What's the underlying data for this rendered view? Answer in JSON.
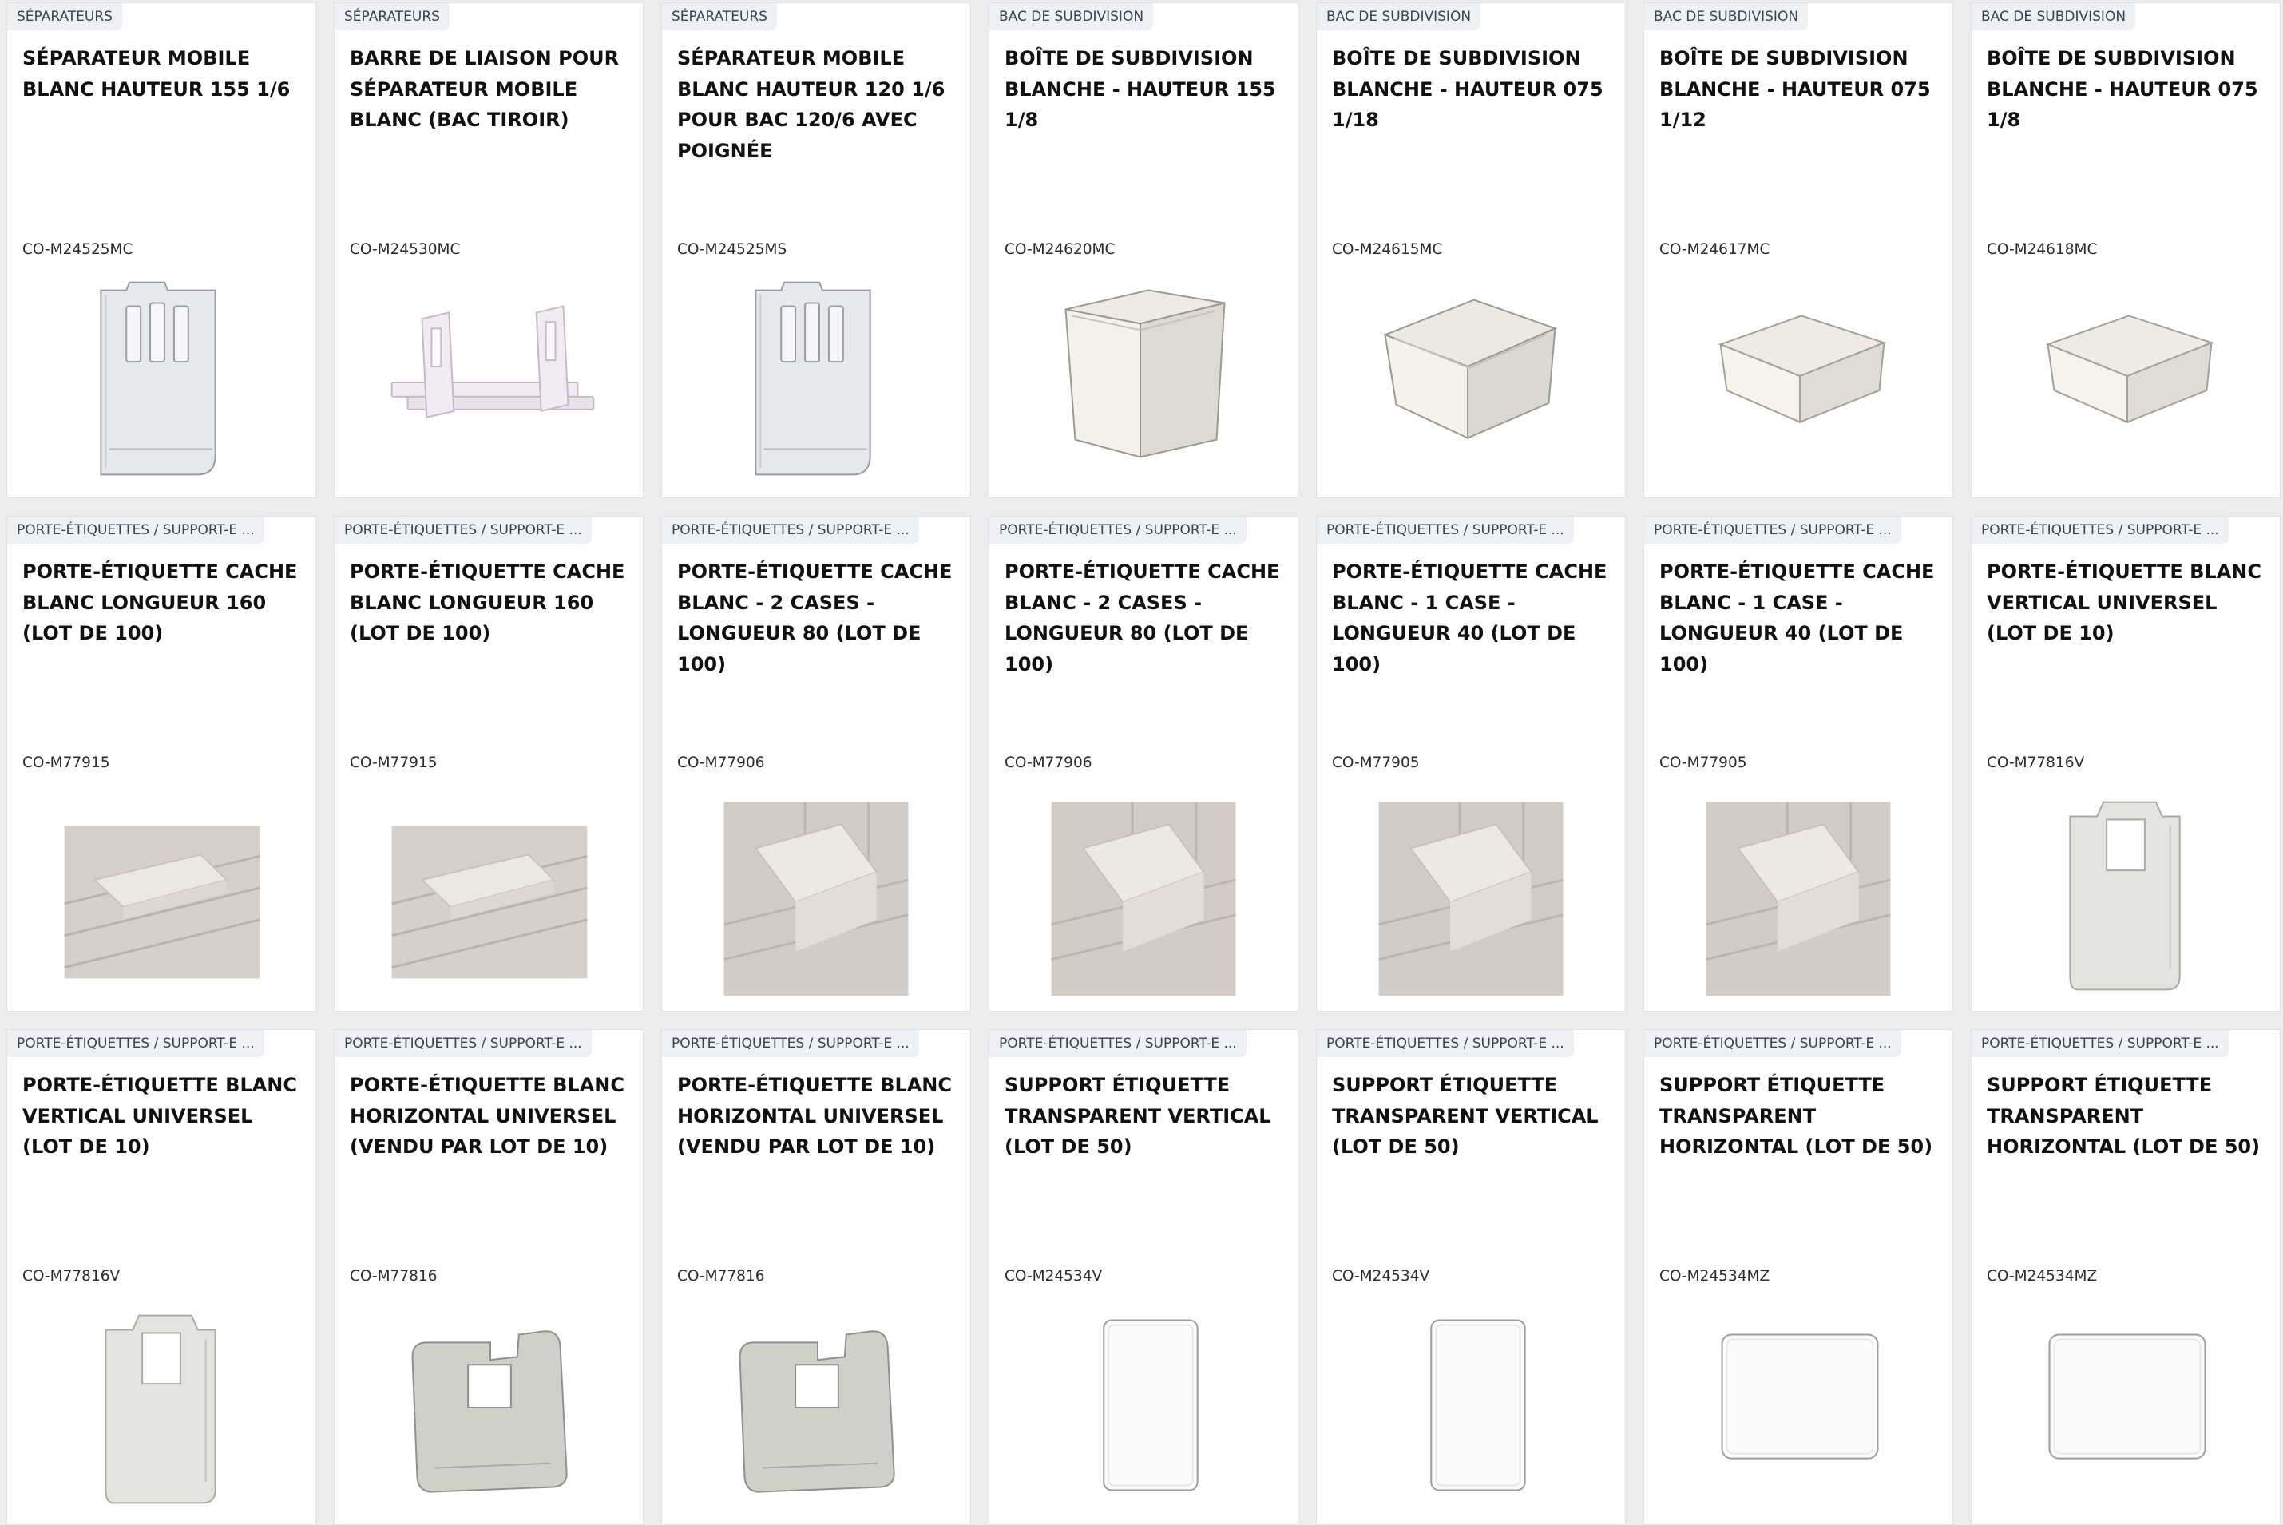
{
  "products": [
    {
      "category": "SÉPARATEURS",
      "title": "SÉPARATEUR MOBILE BLANC HAUTEUR 155 1/6",
      "sku": "CO-M24525MC",
      "image": "tall-divider"
    },
    {
      "category": "SÉPARATEURS",
      "title": "BARRE DE LIAISON POUR SÉPARATEUR MOBILE BLANC (BAC TIROIR)",
      "sku": "CO-M24530MC",
      "image": "link-bar"
    },
    {
      "category": "SÉPARATEURS",
      "title": "SÉPARATEUR MOBILE BLANC HAUTEUR 120 1/6 POUR BAC 120/6 AVEC POIGNÉE",
      "sku": "CO-M24525MS",
      "image": "tall-divider"
    },
    {
      "category": "BAC DE SUBDIVISION",
      "title": "BOÎTE DE SUBDIVISION BLANCHE - HAUTEUR 155 1/8",
      "sku": "CO-M24620MC",
      "image": "box-tall"
    },
    {
      "category": "BAC DE SUBDIVISION",
      "title": "BOÎTE DE SUBDIVISION BLANCHE - HAUTEUR 075 1/18",
      "sku": "CO-M24615MC",
      "image": "box-mid"
    },
    {
      "category": "BAC DE SUBDIVISION",
      "title": "BOÎTE DE SUBDIVISION BLANCHE - HAUTEUR 075 1/12",
      "sku": "CO-M24617MC",
      "image": "box-wide"
    },
    {
      "category": "BAC DE SUBDIVISION",
      "title": "BOÎTE DE SUBDIVISION BLANCHE - HAUTEUR 075 1/8",
      "sku": "CO-M24618MC",
      "image": "box-wide"
    },
    {
      "category": "PORTE-ÉTIQUETTES / SUPPORT-E ...",
      "title": "PORTE-ÉTIQUETTE CACHE BLANC LONGUEUR 160 (LOT DE 100)",
      "sku": "CO-M77915",
      "image": "photo-wide"
    },
    {
      "category": "PORTE-ÉTIQUETTES / SUPPORT-E ...",
      "title": "PORTE-ÉTIQUETTE CACHE BLANC LONGUEUR 160 (LOT DE 100)",
      "sku": "CO-M77915",
      "image": "photo-wide"
    },
    {
      "category": "PORTE-ÉTIQUETTES / SUPPORT-E ...",
      "title": "PORTE-ÉTIQUETTE CACHE BLANC - 2 CASES - LONGUEUR 80 (LOT DE 100)",
      "sku": "CO-M77906",
      "image": "photo-square"
    },
    {
      "category": "PORTE-ÉTIQUETTES / SUPPORT-E ...",
      "title": "PORTE-ÉTIQUETTE CACHE BLANC - 2 CASES - LONGUEUR 80 (LOT DE 100)",
      "sku": "CO-M77906",
      "image": "photo-square"
    },
    {
      "category": "PORTE-ÉTIQUETTES / SUPPORT-E ...",
      "title": "PORTE-ÉTIQUETTE CACHE BLANC - 1 CASE - LONGUEUR 40 (LOT DE 100)",
      "sku": "CO-M77905",
      "image": "photo-square"
    },
    {
      "category": "PORTE-ÉTIQUETTES / SUPPORT-E ...",
      "title": "PORTE-ÉTIQUETTE CACHE BLANC - 1 CASE - LONGUEUR 40 (LOT DE 100)",
      "sku": "CO-M77905",
      "image": "photo-square"
    },
    {
      "category": "PORTE-ÉTIQUETTES / SUPPORT-E ...",
      "title": "PORTE-ÉTIQUETTE BLANC VERTICAL UNIVERSEL (LOT DE 10)",
      "sku": "CO-M77816V",
      "image": "holder-vertical"
    },
    {
      "category": "PORTE-ÉTIQUETTES / SUPPORT-E ...",
      "title": "PORTE-ÉTIQUETTE BLANC VERTICAL UNIVERSEL (LOT DE 10)",
      "sku": "CO-M77816V",
      "image": "holder-vertical"
    },
    {
      "category": "PORTE-ÉTIQUETTES / SUPPORT-E ...",
      "title": "PORTE-ÉTIQUETTE BLANC HORIZONTAL UNIVERSEL (VENDU PAR LOT DE 10)",
      "sku": "CO-M77816",
      "image": "holder-horizontal"
    },
    {
      "category": "PORTE-ÉTIQUETTES / SUPPORT-E ...",
      "title": "PORTE-ÉTIQUETTE BLANC HORIZONTAL UNIVERSEL (VENDU PAR LOT DE 10)",
      "sku": "CO-M77816",
      "image": "holder-horizontal"
    },
    {
      "category": "PORTE-ÉTIQUETTES / SUPPORT-E ...",
      "title": "SUPPORT ÉTIQUETTE TRANSPARENT VERTICAL (LOT DE 50)",
      "sku": "CO-M24534V",
      "image": "card-vertical"
    },
    {
      "category": "PORTE-ÉTIQUETTES / SUPPORT-E ...",
      "title": "SUPPORT ÉTIQUETTE TRANSPARENT VERTICAL (LOT DE 50)",
      "sku": "CO-M24534V",
      "image": "card-vertical"
    },
    {
      "category": "PORTE-ÉTIQUETTES / SUPPORT-E ...",
      "title": "SUPPORT ÉTIQUETTE TRANSPARENT HORIZONTAL (LOT DE 50)",
      "sku": "CO-M24534MZ",
      "image": "card-horizontal"
    },
    {
      "category": "PORTE-ÉTIQUETTES / SUPPORT-E ...",
      "title": "SUPPORT ÉTIQUETTE TRANSPARENT HORIZONTAL (LOT DE 50)",
      "sku": "CO-M24534MZ",
      "image": "card-horizontal"
    }
  ],
  "colors": {
    "page_bg": "#ececec",
    "card_bg": "#ffffff",
    "badge_bg": "#eef0f3",
    "badge_text": "#3b4250",
    "title_text": "#111111"
  }
}
